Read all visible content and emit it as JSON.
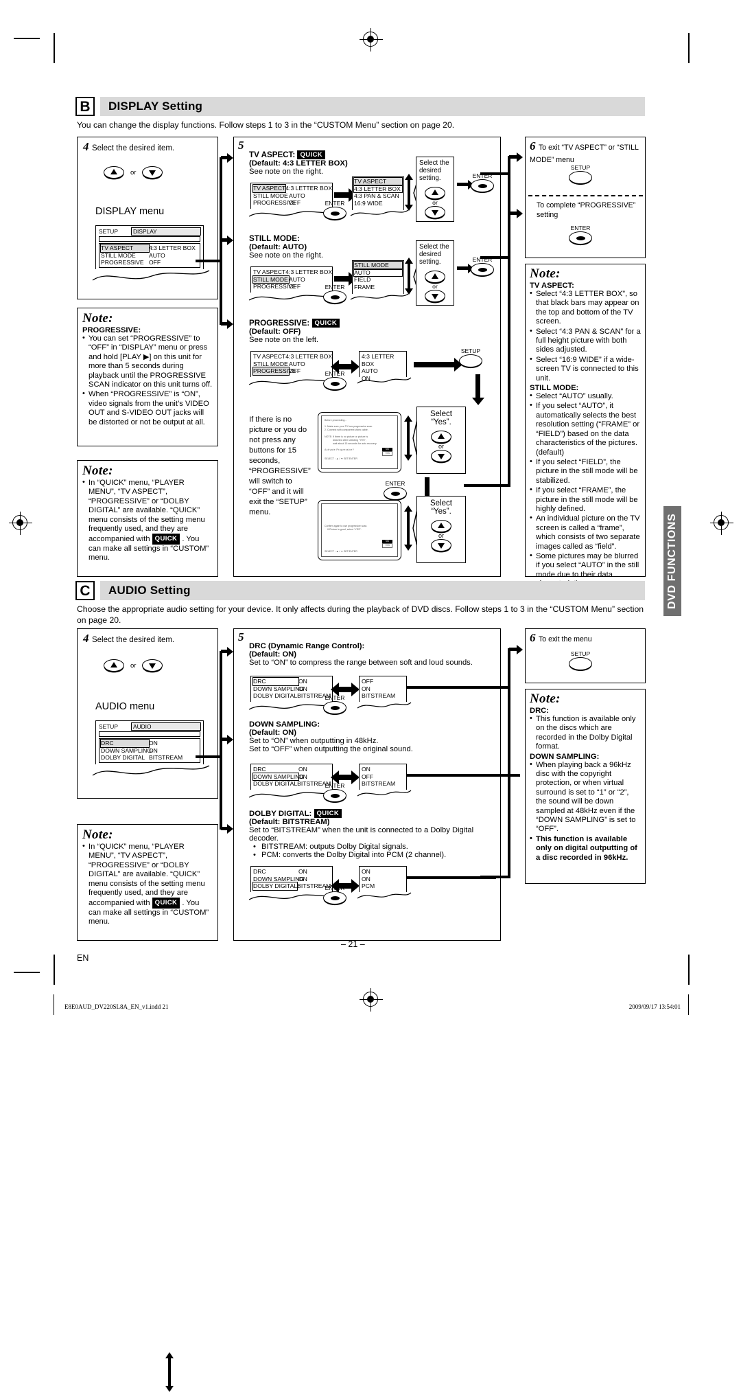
{
  "sections": {
    "b": {
      "letter": "B",
      "title": "DISPLAY Setting",
      "intro": "You can change the display functions. Follow steps 1 to 3 in the “CUSTOM Menu” section on page 20.",
      "step4": {
        "num": "4",
        "text": "Select the desired item.",
        "or": "or",
        "menu_label": "DISPLAY menu",
        "osd": {
          "setup": "SETUP",
          "tab": "DISPLAY",
          "rows": [
            {
              "key": "TV ASPECT",
              "value": "4:3 LETTER BOX"
            },
            {
              "key": "STILL MODE",
              "value": "AUTO"
            },
            {
              "key": "PROGRESSIVE",
              "value": "OFF"
            }
          ]
        }
      },
      "note1": {
        "title": "Note:",
        "sub": "PROGRESSIVE:",
        "items": [
          "You can set “PROGRESSIVE” to “OFF” in “DISPLAY” menu or press and hold [PLAY ▶] on this unit for more than 5 seconds during playback until the PROGRESSIVE SCAN indicator on this unit turns off.",
          "When “PROGRESSIVE” is “ON”, video signals from the unit’s VIDEO OUT and S-VIDEO OUT jacks will be distorted or not be output at all."
        ]
      },
      "note2": {
        "title": "Note:",
        "items": [
          "In “QUICK” menu, “PLAYER MENU”, “TV ASPECT”, “PROGRESSIVE” or “DOLBY DIGITAL” are available. “QUICK” menu consists of the setting menu frequently used, and they are accompanied with QUICK . You can make all settings in “CUSTOM” menu."
        ],
        "quick_badge": "QUICK"
      },
      "step5": {
        "num": "5",
        "blocks": [
          {
            "id": "tv-aspect",
            "heading": "TV ASPECT:",
            "badge": "QUICK",
            "default": "(Default: 4:3 LETTER BOX)",
            "note_ref": "See note on the right.",
            "osd_left": {
              "rows": [
                {
                  "key": "TV ASPECT",
                  "value": "4:3 LETTER BOX",
                  "selected": true
                },
                {
                  "key": "STILL MODE",
                  "value": "AUTO"
                },
                {
                  "key": "PROGRESSIVE",
                  "value": "OFF"
                }
              ]
            },
            "osd_right": {
              "title": "TV ASPECT",
              "options": [
                "4:3 LETTER BOX",
                "4:3 PAN & SCAN",
                "16:9 WIDE"
              ],
              "selected": "4:3 LETTER BOX"
            },
            "enter_label": "ENTER",
            "select_text": "Select the desired setting.",
            "or": "or",
            "enter_label2": "ENTER"
          },
          {
            "id": "still-mode",
            "heading": "STILL MODE:",
            "badge": "",
            "default": "(Default: AUTO)",
            "note_ref": "See note on the right.",
            "osd_left": {
              "rows": [
                {
                  "key": "TV ASPECT",
                  "value": "4:3 LETTER BOX"
                },
                {
                  "key": "STILL MODE",
                  "value": "AUTO",
                  "selected": true
                },
                {
                  "key": "PROGRESSIVE",
                  "value": "OFF"
                }
              ]
            },
            "osd_right": {
              "title": "STILL MODE",
              "options": [
                "AUTO",
                "FIELD",
                "FRAME"
              ],
              "selected": "AUTO"
            },
            "enter_label": "ENTER",
            "select_text": "Select the desired setting.",
            "or": "or",
            "enter_label2": "ENTER"
          },
          {
            "id": "progressive",
            "heading": "PROGRESSIVE:",
            "badge": "QUICK",
            "default": "(Default: OFF)",
            "note_ref": "See note on the left.",
            "osd_left": {
              "rows": [
                {
                  "key": "TV ASPECT",
                  "value": "4:3 LETTER BOX"
                },
                {
                  "key": "STILL MODE",
                  "value": "AUTO"
                },
                {
                  "key": "PROGRESSIVE",
                  "value": "OFF",
                  "selected": true
                }
              ]
            },
            "osd_right_values": [
              "4:3 LETTER BOX",
              "AUTO",
              "ON"
            ],
            "enter_label": "ENTER",
            "setup_label": "SETUP"
          }
        ],
        "progressive_flow": {
          "caption": "If there is no picture or you do not press any buttons for 15 seconds, “PROGRESSIVE” will switch to “OFF” and it will exit the “SETUP” menu.",
          "screen1": {
            "l1": "Before proceeding...",
            "l2": "1. Make sure your TV has progressive scan.",
            "l3": "2. Connect with component video cable.",
            "l4": "NOTE: If there is no picture or picture is",
            "l5": "distorted after selecting “YES”,",
            "l6": "wait about 15 seconds for auto recovery.",
            "l7": "Activate Progressive?",
            "no": "NO",
            "yes": "YES",
            "l8": "SELECT : ▲ / ▼        SET:ENTER"
          },
          "screen2": {
            "l1": "Confirm again to use progressive scan.",
            "l2": "If Picture is good, select “YES”.",
            "no": "NO",
            "yes": "YES",
            "l8": "SELECT : ▲ / ▼        SET:ENTER"
          },
          "select_yes": "Select “Yes”.",
          "or": "or",
          "enter_label": "ENTER"
        }
      },
      "step6": {
        "num": "6",
        "line1": "To exit “TV ASPECT” or “STILL MODE” menu",
        "setup_label": "SETUP",
        "line2": "To complete “PROGRESSIVE” setting",
        "enter_label": "ENTER"
      },
      "note3": {
        "title": "Note:",
        "sub1": "TV ASPECT:",
        "items1": [
          "Select “4:3 LETTER BOX”, so that black bars may appear on the top and bottom of the TV screen.",
          "Select “4:3 PAN & SCAN” for a full height picture with both sides adjusted.",
          "Select “16:9 WIDE” if a wide-screen TV is connected to this unit."
        ],
        "sub2": "STILL MODE:",
        "items2": [
          "Select “AUTO” usually.",
          "If you select “AUTO”, it automatically selects the best resolution setting (“FRAME” or “FIELD”) based on the data characteristics of the pictures. (default)",
          "If you select “FIELD”, the picture in the still mode will be stabilized.",
          "If you select “FRAME”, the picture in the still mode will be highly defined.",
          "An individual picture on the TV screen is called a “frame”, which consists of two separate images called as “field”.",
          "Some pictures may be blurred if you select “AUTO” in the still mode due to their data characteristics."
        ]
      }
    },
    "c": {
      "letter": "C",
      "title": "AUDIO Setting",
      "intro": "Choose the appropriate audio setting for your device. It only affects during the playback of DVD discs. Follow steps 1 to 3 in the “CUSTOM Menu” section on page 20.",
      "step4": {
        "num": "4",
        "text": "Select the desired item.",
        "or": "or",
        "menu_label": "AUDIO menu",
        "osd": {
          "setup": "SETUP",
          "tab": "AUDIO",
          "rows": [
            {
              "key": "DRC",
              "value": "ON"
            },
            {
              "key": "DOWN SAMPLING",
              "value": "ON"
            },
            {
              "key": "DOLBY DIGITAL",
              "value": "BITSTREAM"
            }
          ]
        }
      },
      "note1": {
        "title": "Note:",
        "items": [
          "In “QUICK” menu, “PLAYER MENU”, “TV ASPECT”, “PROGRESSIVE” or “DOLBY DIGITAL” are available. “QUICK” menu consists of the setting menu frequently used, and they are accompanied with QUICK . You can make all settings in “CUSTOM” menu."
        ],
        "quick_badge": "QUICK"
      },
      "step5": {
        "num": "5",
        "blocks": [
          {
            "id": "drc",
            "heading": "DRC (Dynamic Range Control):",
            "badge": "",
            "default": "(Default: ON)",
            "desc": [
              "Set to “ON” to compress the range between soft and loud sounds."
            ],
            "bullets": [],
            "osd_left": {
              "rows": [
                {
                  "key": "DRC",
                  "value": "ON",
                  "selected": true
                },
                {
                  "key": "DOWN SAMPLING",
                  "value": "ON"
                },
                {
                  "key": "DOLBY DIGITAL",
                  "value": "BITSTREAM"
                }
              ]
            },
            "osd_right_values": [
              "OFF",
              "ON",
              "BITSTREAM"
            ],
            "enter_label": "ENTER"
          },
          {
            "id": "down-sampling",
            "heading": "DOWN SAMPLING:",
            "badge": "",
            "default": "(Default: ON)",
            "desc": [
              "Set to “ON” when outputting in 48kHz.",
              "Set to “OFF” when outputting the original sound."
            ],
            "bullets": [],
            "osd_left": {
              "rows": [
                {
                  "key": "DRC",
                  "value": "ON"
                },
                {
                  "key": "DOWN SAMPLING",
                  "value": "ON",
                  "selected": true
                },
                {
                  "key": "DOLBY DIGITAL",
                  "value": "BITSTREAM"
                }
              ]
            },
            "osd_right_values": [
              "ON",
              "OFF",
              "BITSTREAM"
            ],
            "enter_label": "ENTER"
          },
          {
            "id": "dolby-digital",
            "heading": "DOLBY DIGITAL:",
            "badge": "QUICK",
            "default": "(Default: BITSTREAM)",
            "desc": [
              "Set to “BITSTREAM” when the unit is connected to a Dolby Digital decoder."
            ],
            "bullets": [
              "BITSTREAM: outputs Dolby Digital signals.",
              "PCM: converts the Dolby Digital into PCM (2 channel)."
            ],
            "osd_left": {
              "rows": [
                {
                  "key": "DRC",
                  "value": "ON"
                },
                {
                  "key": "DOWN SAMPLING",
                  "value": "ON"
                },
                {
                  "key": "DOLBY DIGITAL",
                  "value": "BITSTREAM",
                  "selected": true
                }
              ]
            },
            "osd_right_values": [
              "ON",
              "ON",
              "PCM"
            ],
            "enter_label": "ENTER"
          }
        ]
      },
      "step6": {
        "num": "6",
        "line1": "To exit the menu",
        "setup_label": "SETUP"
      },
      "note2": {
        "title": "Note:",
        "sub1": "DRC:",
        "items1": [
          "This function is available only on the discs which are recorded in the Dolby Digital format."
        ],
        "sub2": "DOWN SAMPLING:",
        "items2": [
          "When playing back a 96kHz disc with the copyright protection, or when virtual surround is set to “1” or “2”, the sound will be down sampled at 48kHz even if the “DOWN SAMPLING” is set to “OFF”."
        ],
        "items2_bold": [
          "This function is available only on digital outputting of a disc recorded in 96kHz."
        ]
      }
    }
  },
  "sidetab": {
    "label": "DVD FUNCTIONS"
  },
  "footer": {
    "page_number": "– 21 –",
    "en": "EN",
    "filename": "E8E0AUD_DV220SL8A_EN_v1.indd   21",
    "timestamp": "2009/09/17   13:54:01"
  }
}
